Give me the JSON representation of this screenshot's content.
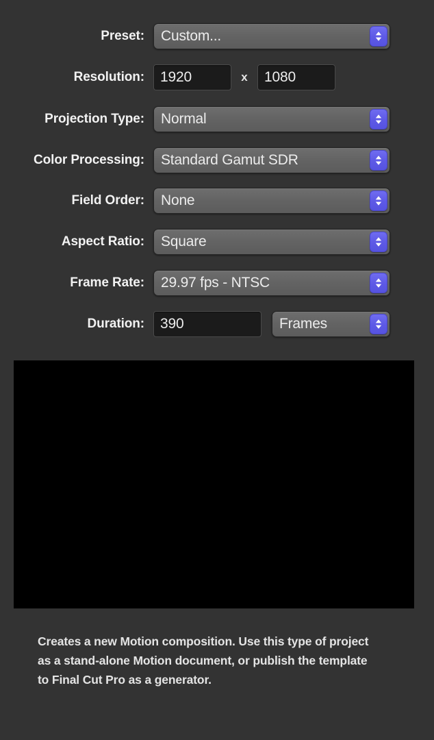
{
  "panel": {
    "background_color": "#333333",
    "accent_color": "#5d59e6"
  },
  "rows": [
    {
      "label": "Preset:",
      "type": "popup",
      "value": "Custom...",
      "name": "preset"
    },
    {
      "label": "Resolution:",
      "type": "resolution",
      "width_value": "1920",
      "separator": "x",
      "height_value": "1080",
      "name": "resolution"
    },
    {
      "label": "Projection Type:",
      "type": "popup",
      "value": "Normal",
      "name": "projection-type"
    },
    {
      "label": "Color Processing:",
      "type": "popup",
      "value": "Standard Gamut SDR",
      "name": "color-processing"
    },
    {
      "label": "Field Order:",
      "type": "popup",
      "value": "None",
      "name": "field-order"
    },
    {
      "label": "Aspect Ratio:",
      "type": "popup",
      "value": "Square",
      "name": "aspect-ratio"
    },
    {
      "label": "Frame Rate:",
      "type": "popup",
      "value": "29.97 fps - NTSC",
      "name": "frame-rate"
    },
    {
      "label": "Duration:",
      "type": "duration",
      "value": "390",
      "units_value": "Frames",
      "name": "duration"
    }
  ],
  "preview": {
    "name": "preview-thumbnail",
    "color": "#000000"
  },
  "description": {
    "text": "Creates a new Motion composition. Use this type of project as a stand-alone Motion document, or publish the template to Final Cut Pro as a generator."
  },
  "icons": {
    "stepper": "up-down-chevron-icon"
  }
}
